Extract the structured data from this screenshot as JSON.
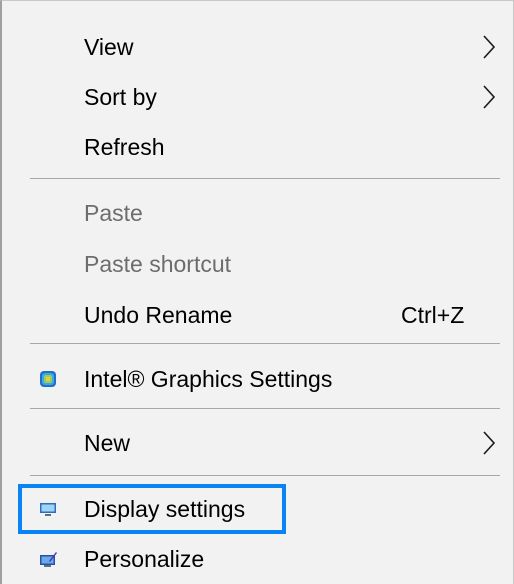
{
  "menu": {
    "items": {
      "view": {
        "label": "View",
        "icon": "chevron-right-icon"
      },
      "sort_by": {
        "label": "Sort by",
        "icon": "chevron-right-icon"
      },
      "refresh": {
        "label": "Refresh"
      },
      "paste": {
        "label": "Paste",
        "disabled": true
      },
      "paste_shortcut": {
        "label": "Paste shortcut",
        "disabled": true
      },
      "undo_rename": {
        "label": "Undo Rename",
        "shortcut": "Ctrl+Z"
      },
      "intel_graphics": {
        "label": "Intel® Graphics Settings",
        "icon": "intel-graphics-icon"
      },
      "new": {
        "label": "New",
        "icon": "chevron-right-icon"
      },
      "display_settings": {
        "label": "Display settings",
        "icon": "display-icon",
        "highlighted": true
      },
      "personalize": {
        "label": "Personalize",
        "icon": "personalize-icon"
      }
    }
  },
  "colors": {
    "menu_background": "#f2f2f2",
    "disabled_text": "#6d6d6d",
    "highlight_border": "#0a84f5",
    "separator": "#a8a8a8"
  }
}
